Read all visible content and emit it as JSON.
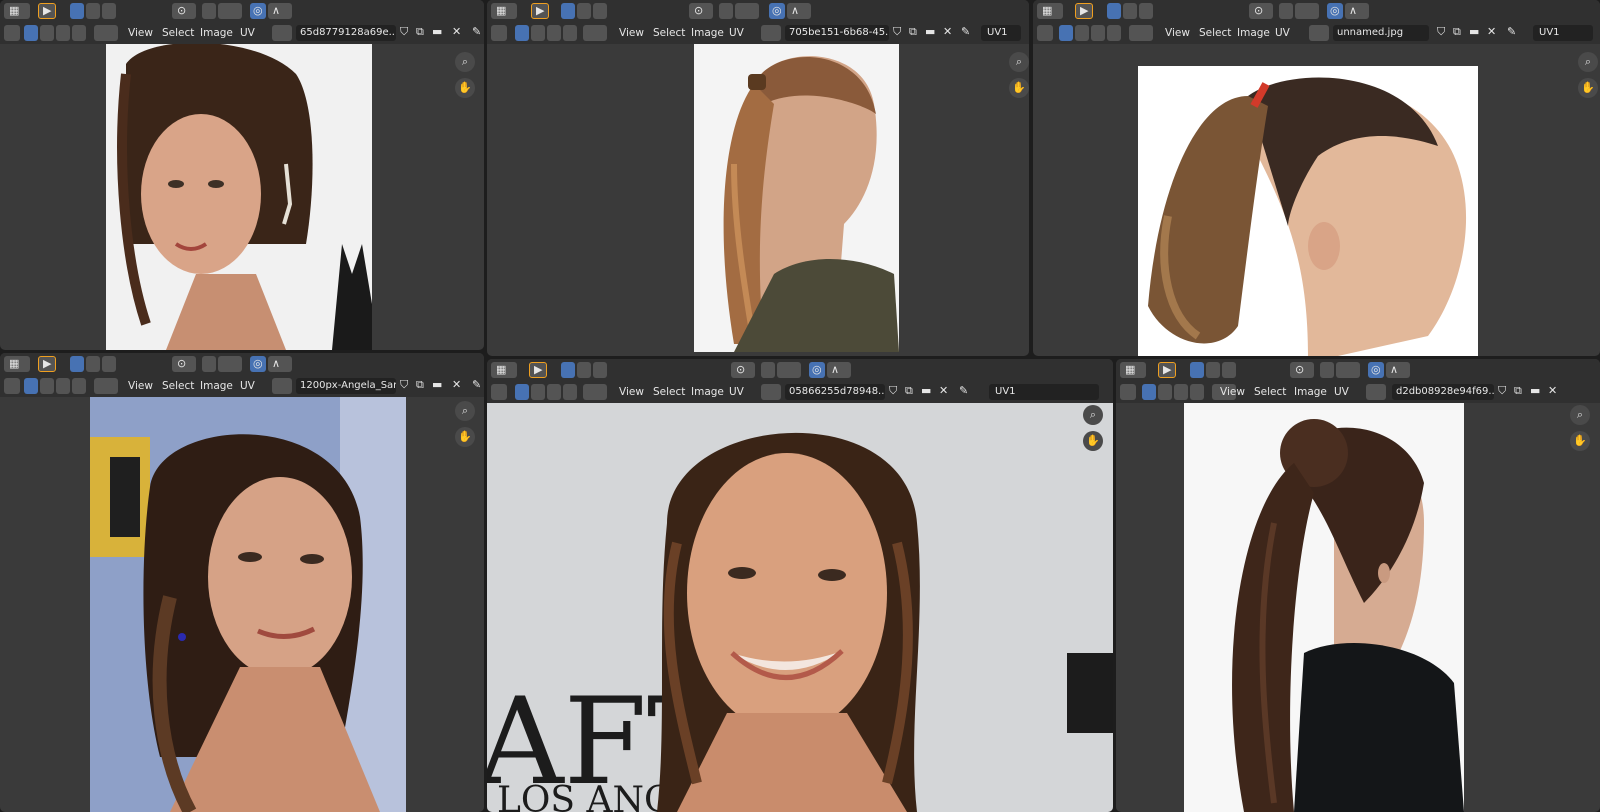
{
  "app": {
    "name": "Blender",
    "editor": "Image Editor"
  },
  "menus": [
    "View",
    "Select",
    "Image",
    "UV"
  ],
  "uv_map": "UV1",
  "icons": {
    "editor_type": "image-editor-type-icon",
    "select_tool": "cursor-select-icon",
    "zoom": "zoom-icon",
    "pan": "hand-pan-icon",
    "pin": "pin-icon",
    "close": "close-icon",
    "new": "new-image-icon",
    "open": "open-folder-icon",
    "fake_user": "shield-icon"
  },
  "colors": {
    "accent": "#4772b3",
    "active_tool_outline": "#f0a020",
    "header": "#303030",
    "viewport": "#3a3a3a"
  },
  "panels": [
    {
      "image_name": "65d8779128a69e..."
    },
    {
      "image_name": "705be151-6b68-45..."
    },
    {
      "image_name": "unnamed.jpg"
    },
    {
      "image_name": "1200px-Angela_Sar..."
    },
    {
      "image_name": "05866255d78948..."
    },
    {
      "image_name": "d2db08928e94f69..."
    }
  ],
  "photo_text": {
    "backdrop_letters": "AFTA",
    "backdrop_sub": "LOS ANGELES"
  }
}
